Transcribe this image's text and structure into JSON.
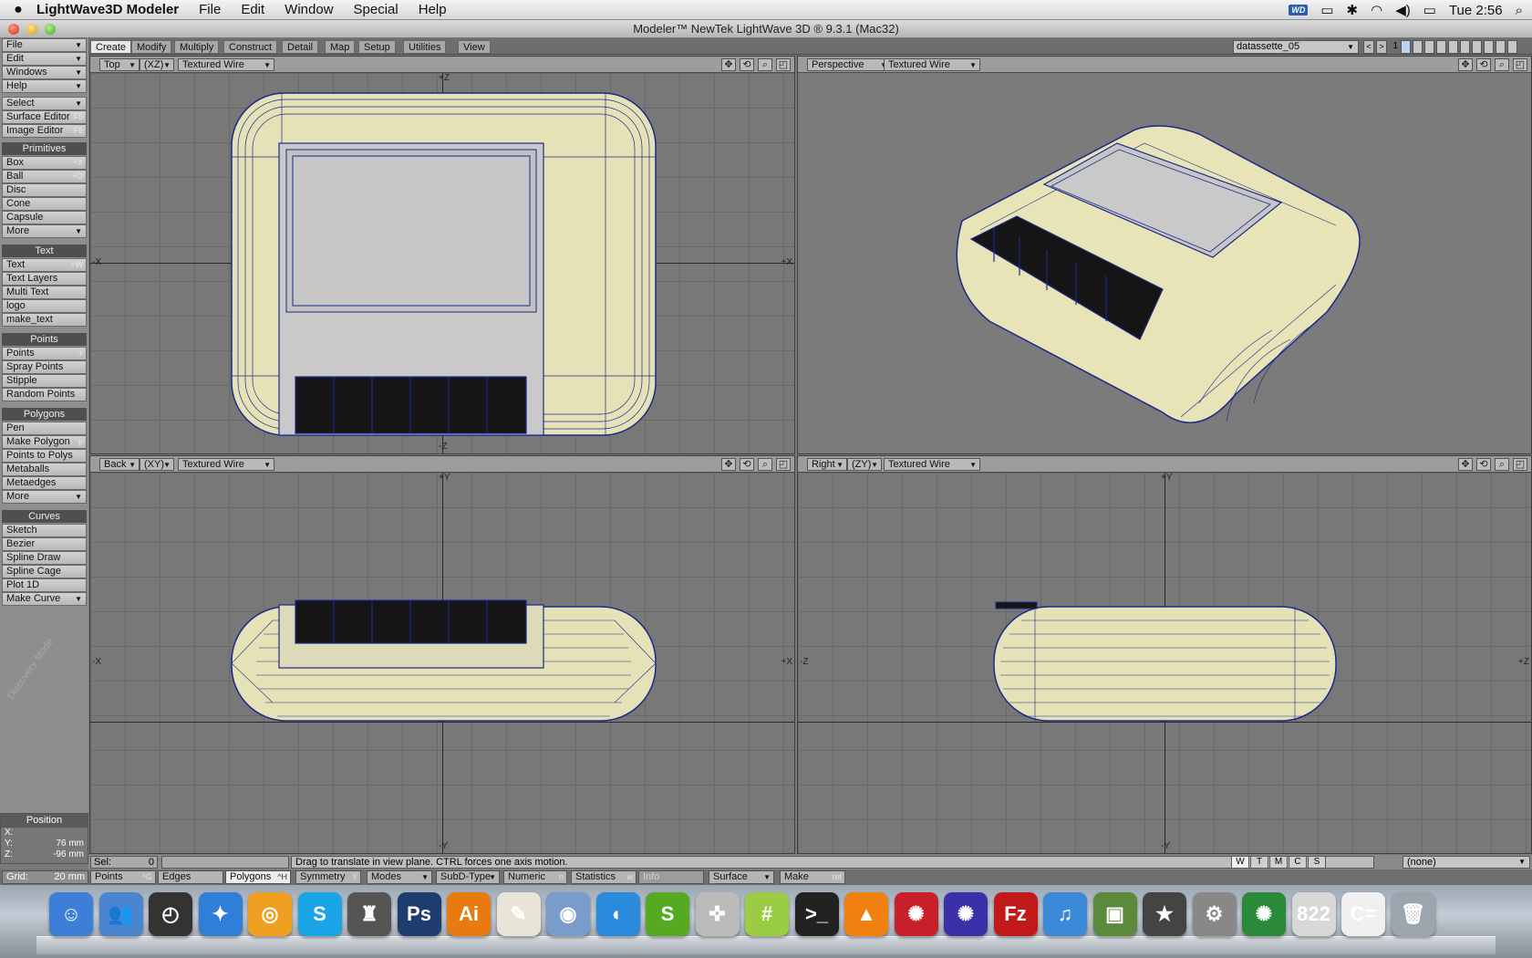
{
  "menubar": {
    "app_name": "LightWave3D Modeler",
    "menus": [
      "File",
      "Edit",
      "Window",
      "Special",
      "Help"
    ],
    "wd_badge": "WD",
    "clock": "Tue 2:56"
  },
  "window": {
    "title": "Modeler™ NewTek LightWave 3D ® 9.3.1 (Mac32)"
  },
  "toolbar": {
    "top": [
      {
        "label": "File"
      },
      {
        "label": "Edit"
      },
      {
        "label": "Windows"
      },
      {
        "label": "Help"
      }
    ],
    "select": "Select",
    "surface_editor": "Surface Editor",
    "surface_editor_sc": "F5",
    "image_editor": "Image Editor",
    "image_editor_sc": "F6",
    "primitives_head": "Primitives",
    "primitives": [
      {
        "label": "Box",
        "sc": "+X"
      },
      {
        "label": "Ball",
        "sc": "+O"
      },
      {
        "label": "Disc",
        "sc": ""
      },
      {
        "label": "Cone",
        "sc": ""
      },
      {
        "label": "Capsule",
        "sc": ""
      },
      {
        "label": "More",
        "sc": ""
      }
    ],
    "text_head": "Text",
    "text": [
      {
        "label": "Text",
        "sc": "+W"
      },
      {
        "label": "Text Layers",
        "sc": ""
      },
      {
        "label": "Multi Text",
        "sc": ""
      },
      {
        "label": "logo",
        "sc": ""
      },
      {
        "label": "make_text",
        "sc": ""
      }
    ],
    "points_head": "Points",
    "points": [
      {
        "label": "Points",
        "sc": "+"
      },
      {
        "label": "Spray Points",
        "sc": ""
      },
      {
        "label": "Stipple",
        "sc": ""
      },
      {
        "label": "Random Points",
        "sc": ""
      }
    ],
    "polygons_head": "Polygons",
    "polygons": [
      {
        "label": "Pen",
        "sc": ""
      },
      {
        "label": "Make Polygon",
        "sc": "p"
      },
      {
        "label": "Points to Polys",
        "sc": ""
      },
      {
        "label": "Metaballs",
        "sc": ""
      },
      {
        "label": "Metaedges",
        "sc": ""
      },
      {
        "label": "More",
        "sc": ""
      }
    ],
    "curves_head": "Curves",
    "curves": [
      {
        "label": "Sketch",
        "sc": ""
      },
      {
        "label": "Bezier",
        "sc": ""
      },
      {
        "label": "Spline Draw",
        "sc": ""
      },
      {
        "label": "Spline Cage",
        "sc": ""
      },
      {
        "label": "Plot 1D",
        "sc": ""
      },
      {
        "label": "Make Curve",
        "sc": ""
      }
    ],
    "watermark": "Discovery Mode",
    "position": {
      "head": "Position",
      "x_label": "X:",
      "x": "",
      "y_label": "Y:",
      "y": "76 mm",
      "z_label": "Z:",
      "z": "-96 mm"
    }
  },
  "tabs": [
    "Create",
    "Modify",
    "Multiply",
    "Construct",
    "Detail",
    "Map",
    "Setup",
    "Utilities",
    "View"
  ],
  "active_tab": "Create",
  "layer": {
    "name": "datassette_05",
    "number": "1"
  },
  "viewports": {
    "top": {
      "view": "Top",
      "axes": "(XZ)",
      "mode": "Textured Wire",
      "ax_top": "+Z",
      "ax_bottom": "-Z",
      "ax_left": "-X",
      "ax_right": "+X"
    },
    "persp": {
      "view": "Perspective",
      "mode": "Textured Wire"
    },
    "back": {
      "view": "Back",
      "axes": "(XY)",
      "mode": "Textured Wire",
      "ax_top": "+Y",
      "ax_bottom": "-Y",
      "ax_left": "-X",
      "ax_right": "+X"
    },
    "right": {
      "view": "Right",
      "axes": "(ZY)",
      "mode": "Textured Wire",
      "ax_top": "+Y",
      "ax_bottom": "-Y",
      "ax_left": "-Z",
      "ax_right": "+Z"
    }
  },
  "status": {
    "sel_label": "Sel:",
    "sel_value": "0",
    "message": "Drag to translate in view plane. CTRL forces one axis motion.",
    "wtmcs": [
      "W",
      "T",
      "M",
      "C",
      "S"
    ],
    "surface": "(none)"
  },
  "bottom": {
    "grid_label": "Grid:",
    "grid_value": "20 mm",
    "points": "Points",
    "points_sc": "^G",
    "edges": "Edges",
    "polygons": "Polygons",
    "polygons_sc": "^H",
    "symmetry": "Symmetry",
    "symmetry_sc": "Y",
    "modes": "Modes",
    "subd": "SubD-Type",
    "numeric": "Numeric",
    "numeric_sc": "n",
    "statistics": "Statistics",
    "statistics_sc": "w",
    "info": "Info",
    "surface": "Surface",
    "make": "Make",
    "make_sc": "ret"
  },
  "dock": [
    {
      "name": "finder-icon",
      "color": "#3d7fd8",
      "glyph": "☺"
    },
    {
      "name": "ichat-icon",
      "color": "#4a86d0",
      "glyph": "👥"
    },
    {
      "name": "dashboard-icon",
      "color": "#333333",
      "glyph": "◴"
    },
    {
      "name": "safari-icon",
      "color": "#2f7ed8",
      "glyph": "✦"
    },
    {
      "name": "mail-icon",
      "color": "#f0a020",
      "glyph": "◎"
    },
    {
      "name": "skype-icon",
      "color": "#1aa5e8",
      "glyph": "S"
    },
    {
      "name": "transmit-icon",
      "color": "#555555",
      "glyph": "♜"
    },
    {
      "name": "photoshop-icon",
      "color": "#1e3c6e",
      "glyph": "Ps"
    },
    {
      "name": "illustrator-icon",
      "color": "#e87a10",
      "glyph": "Ai"
    },
    {
      "name": "textedit-icon",
      "color": "#e8e4d8",
      "glyph": "✎"
    },
    {
      "name": "preview-icon",
      "color": "#7a9ccc",
      "glyph": "◉"
    },
    {
      "name": "spiral-icon",
      "color": "#2a8adc",
      "glyph": "◐"
    },
    {
      "name": "skim-icon",
      "color": "#55aa22",
      "glyph": "S"
    },
    {
      "name": "joystick-icon",
      "color": "#bbbbbb",
      "glyph": "✜"
    },
    {
      "name": "adium-icon",
      "color": "#9acc44",
      "glyph": "#"
    },
    {
      "name": "terminal-icon",
      "color": "#222222",
      "glyph": ">_"
    },
    {
      "name": "vlc-icon",
      "color": "#f08010",
      "glyph": "▲"
    },
    {
      "name": "lightwave-icon",
      "color": "#c8202a",
      "glyph": "✺"
    },
    {
      "name": "lightwave-modeler-icon",
      "color": "#3b30a8",
      "glyph": "✺"
    },
    {
      "name": "filezilla-icon",
      "color": "#c21a1a",
      "glyph": "Fz"
    },
    {
      "name": "itunes-icon",
      "color": "#3a8ad8",
      "glyph": "♫"
    },
    {
      "name": "iphoto-icon",
      "color": "#5a8a3a",
      "glyph": "▣"
    },
    {
      "name": "imovie-icon",
      "color": "#444444",
      "glyph": "★"
    },
    {
      "name": "system-preferences-icon",
      "color": "#888888",
      "glyph": "⚙"
    },
    {
      "name": "lightwave-hub-icon",
      "color": "#2a8a3a",
      "glyph": "✺"
    },
    {
      "name": "document-icon",
      "color": "#d8d8d8",
      "glyph": "822"
    },
    {
      "name": "commodore-icon",
      "color": "#f0f0f0",
      "glyph": "C="
    },
    {
      "name": "trash-icon",
      "color": "#9ca4ae",
      "glyph": "🗑"
    }
  ]
}
